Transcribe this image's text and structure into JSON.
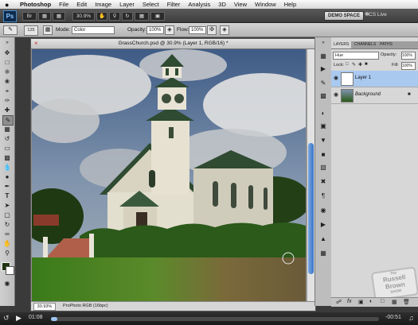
{
  "menubar": {
    "app": "Photoshop",
    "items": [
      "File",
      "Edit",
      "Image",
      "Layer",
      "Select",
      "Filter",
      "Analysis",
      "3D",
      "View",
      "Window",
      "Help"
    ]
  },
  "appbar": {
    "logo": "Ps",
    "zoom": "30.9%",
    "workspace_button": "DEMO SPACE",
    "cs_live": "CS Live"
  },
  "options": {
    "brush_size": "125",
    "mode_label": "Mode:",
    "mode_value": "Color",
    "opacity_label": "Opacity:",
    "opacity_value": "100%",
    "flow_label": "Flow:",
    "flow_value": "100%"
  },
  "document": {
    "title": "GrassChurch.psd @ 30.9% (Layer 1, RGB/16) *",
    "zoom": "30.93%",
    "profile": "ProPhoto RGB (16bpc)"
  },
  "layers_panel": {
    "tabs": [
      "LAYERS",
      "CHANNELS",
      "PATHS"
    ],
    "blend_mode": "Hue",
    "opacity_label": "Opacity:",
    "opacity_value": "100%",
    "lock_label": "Lock:",
    "fill_label": "Fill:",
    "fill_value": "100%",
    "layers": [
      {
        "name": "Layer 1",
        "selected": true
      },
      {
        "name": "Background",
        "selected": false
      }
    ]
  },
  "watermark": {
    "small": "The",
    "line1": "Russell",
    "line2": "Brown",
    "line3": "SHOW"
  },
  "video": {
    "elapsed": "01:08",
    "remaining": "-00:51",
    "progress": 0.02
  },
  "colors": {
    "selected_layer": "#a9c9ef",
    "scroll_thumb": "#3a74c8"
  }
}
